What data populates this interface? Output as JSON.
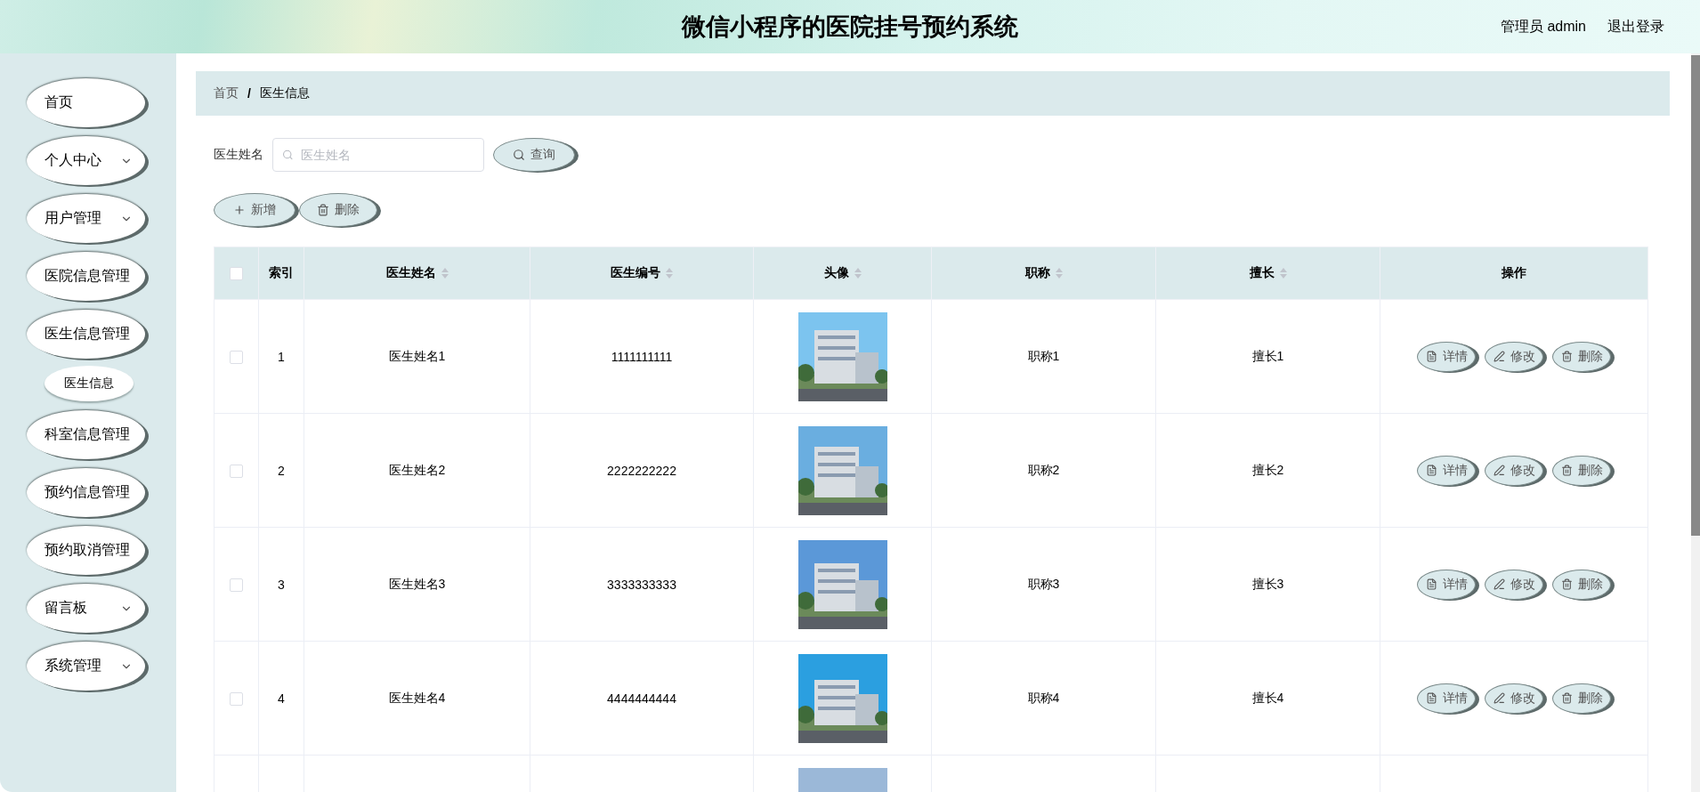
{
  "header": {
    "title": "微信小程序的医院挂号预约系统",
    "user": "管理员 admin",
    "logout": "退出登录"
  },
  "sidebar": {
    "items": [
      {
        "label": "首页",
        "expandable": false
      },
      {
        "label": "个人中心",
        "expandable": true
      },
      {
        "label": "用户管理",
        "expandable": true
      },
      {
        "label": "医院信息管理",
        "expandable": false
      },
      {
        "label": "医生信息管理",
        "expandable": false,
        "children": [
          {
            "label": "医生信息",
            "selected": true
          }
        ]
      },
      {
        "label": "科室信息管理",
        "expandable": false
      },
      {
        "label": "预约信息管理",
        "expandable": false
      },
      {
        "label": "预约取消管理",
        "expandable": false
      },
      {
        "label": "留言板",
        "expandable": true
      },
      {
        "label": "系统管理",
        "expandable": true
      }
    ]
  },
  "breadcrumb": {
    "separator": "/",
    "items": [
      "首页",
      "医生信息"
    ]
  },
  "search": {
    "label": "医生姓名",
    "placeholder": "医生姓名",
    "button": "查询"
  },
  "toolbar": {
    "add": "新增",
    "delete": "删除"
  },
  "table": {
    "select_all_checked": false,
    "columns": [
      {
        "label": "索引",
        "sortable": false
      },
      {
        "label": "医生姓名",
        "sortable": true
      },
      {
        "label": "医生编号",
        "sortable": true
      },
      {
        "label": "头像",
        "sortable": true
      },
      {
        "label": "职称",
        "sortable": true
      },
      {
        "label": "擅长",
        "sortable": true
      },
      {
        "label": "操作",
        "sortable": false
      }
    ],
    "rows": [
      {
        "checked": false,
        "index": "1",
        "name": "医生姓名1",
        "number": "1111111111",
        "photo": {
          "kind": "picture"
        },
        "title": "职称1",
        "specialty": "擅长1",
        "actions": [
          "详情",
          "修改",
          "删除"
        ]
      },
      {
        "checked": false,
        "index": "2",
        "name": "医生姓名2",
        "number": "2222222222",
        "photo": {
          "kind": "picture"
        },
        "title": "职称2",
        "specialty": "擅长2",
        "actions": [
          "详情",
          "修改",
          "删除"
        ]
      },
      {
        "checked": false,
        "index": "3",
        "name": "医生姓名3",
        "number": "3333333333",
        "photo": {
          "kind": "picture"
        },
        "title": "职称3",
        "specialty": "擅长3",
        "actions": [
          "详情",
          "修改",
          "删除"
        ]
      },
      {
        "checked": false,
        "index": "4",
        "name": "医生姓名4",
        "number": "4444444444",
        "photo": {
          "kind": "picture"
        },
        "title": "职称4",
        "specialty": "擅长4",
        "actions": [
          "详情",
          "修改",
          "删除"
        ]
      },
      {
        "photo": {
          "kind": "picture"
        }
      }
    ]
  }
}
